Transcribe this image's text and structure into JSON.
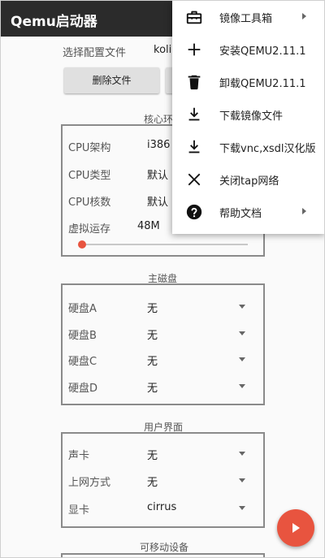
{
  "app": {
    "title": "Qemu启动器"
  },
  "config": {
    "label": "选择配置文件",
    "value": "koli"
  },
  "buttons": {
    "delete_file": "删除文件"
  },
  "core": {
    "title": "核心环",
    "cpu_arch_label": "CPU架构",
    "cpu_arch_value": "i386",
    "cpu_type_label": "CPU类型",
    "cpu_type_value": "默认",
    "cpu_cores_label": "CPU核数",
    "cpu_cores_value": "默认",
    "memory_label": "虚拟运存",
    "memory_value": "48M",
    "memory_slider_level": 0.0
  },
  "main_disk": {
    "title": "主磁盘",
    "rows": [
      {
        "label": "硬盘A",
        "value": "无"
      },
      {
        "label": "硬盘B",
        "value": "无"
      },
      {
        "label": "硬盘C",
        "value": "无"
      },
      {
        "label": "硬盘D",
        "value": "无"
      }
    ]
  },
  "ui": {
    "title": "用户界面",
    "rows": [
      {
        "label": "声卡",
        "value": "无"
      },
      {
        "label": "上网方式",
        "value": "无"
      },
      {
        "label": "显卡",
        "value": "cirrus"
      }
    ]
  },
  "removable": {
    "title": "可移动设备"
  },
  "menu": {
    "items": [
      {
        "icon": "toolbox-icon",
        "label": "镜像工具箱",
        "submenu": true
      },
      {
        "icon": "plus-icon",
        "label": "安装QEMU2.11.1",
        "submenu": false
      },
      {
        "icon": "trash-icon",
        "label": "卸载QEMU2.11.1",
        "submenu": false
      },
      {
        "icon": "download-icon",
        "label": "下载镜像文件",
        "submenu": false
      },
      {
        "icon": "download-icon",
        "label": "下载vnc,xsdl汉化版",
        "submenu": false
      },
      {
        "icon": "close-icon",
        "label": "关闭tap网络",
        "submenu": false
      },
      {
        "icon": "help-icon",
        "label": "帮助文档",
        "submenu": true
      }
    ]
  },
  "colors": {
    "appbar": "#2b2b2b",
    "accent": "#e8543f",
    "panel_border": "#8a8a8a"
  }
}
